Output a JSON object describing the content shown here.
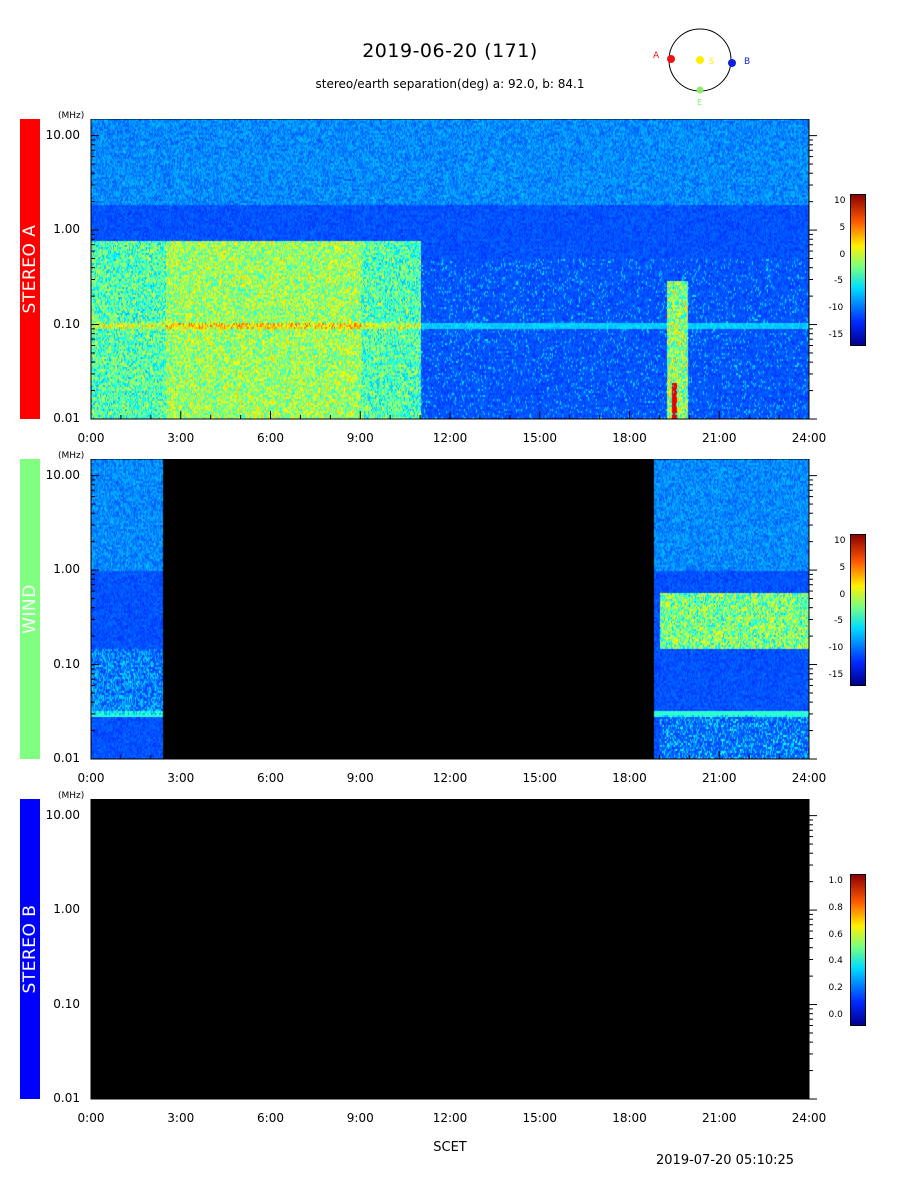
{
  "header": {
    "title": "2019-06-20 (171)",
    "subtitle": "stereo/earth separation(deg) a:  92.0, b:  84.1"
  },
  "orbit_legend": {
    "labels": {
      "a": "A",
      "s": "S",
      "b": "B",
      "e": "E"
    },
    "colors": {
      "a": "#ee1111",
      "s": "#ffee00",
      "b": "#1122dd",
      "e": "#88ee66"
    }
  },
  "footer": {
    "xlabel": "SCET",
    "timestamp": "2019-07-20 05:10:25"
  },
  "chart_data": [
    {
      "type": "heatmap",
      "panel": "STEREO A",
      "label_color": "#ff0000",
      "y_unit": "(MHz)",
      "y_scale": "log",
      "ylim": [
        0.01,
        15.0
      ],
      "yticks": [
        "10.00",
        "1.00",
        "0.10",
        "0.01"
      ],
      "xticks": [
        "0:00",
        "3:00",
        "6:00",
        "9:00",
        "12:00",
        "15:00",
        "18:00",
        "21:00",
        "24:00"
      ],
      "xlim_hours": [
        0,
        24
      ],
      "data_gaps_hours": [],
      "colorbar": {
        "min": -15,
        "max": 10,
        "ticks": [
          "10",
          "5",
          "0",
          "-5",
          "-10",
          "-15"
        ]
      }
    },
    {
      "type": "heatmap",
      "panel": "WIND",
      "label_color": "#80ff80",
      "y_unit": "(MHz)",
      "y_scale": "log",
      "ylim": [
        0.01,
        15.0
      ],
      "yticks": [
        "10.00",
        "1.00",
        "0.10",
        "0.01"
      ],
      "xticks": [
        "0:00",
        "3:00",
        "6:00",
        "9:00",
        "12:00",
        "15:00",
        "18:00",
        "21:00",
        "24:00"
      ],
      "xlim_hours": [
        0,
        24
      ],
      "data_gaps_hours": [
        [
          2.4,
          18.8
        ]
      ],
      "colorbar": {
        "min": -15,
        "max": 10,
        "ticks": [
          "10",
          "5",
          "0",
          "-5",
          "-10",
          "-15"
        ]
      }
    },
    {
      "type": "heatmap",
      "panel": "STEREO B",
      "label_color": "#0000ff",
      "y_unit": "(MHz)",
      "y_scale": "log",
      "ylim": [
        0.01,
        15.0
      ],
      "yticks": [
        "10.00",
        "1.00",
        "0.10",
        "0.01"
      ],
      "xticks": [
        "0:00",
        "3:00",
        "6:00",
        "9:00",
        "12:00",
        "15:00",
        "18:00",
        "21:00",
        "24:00"
      ],
      "xlim_hours": [
        0,
        24
      ],
      "data_gaps_hours": [
        [
          0,
          24
        ]
      ],
      "colorbar": {
        "min": 0.0,
        "max": 1.0,
        "ticks": [
          "1.0",
          "0.8",
          "0.6",
          "0.4",
          "0.2",
          "0.0"
        ]
      }
    }
  ]
}
